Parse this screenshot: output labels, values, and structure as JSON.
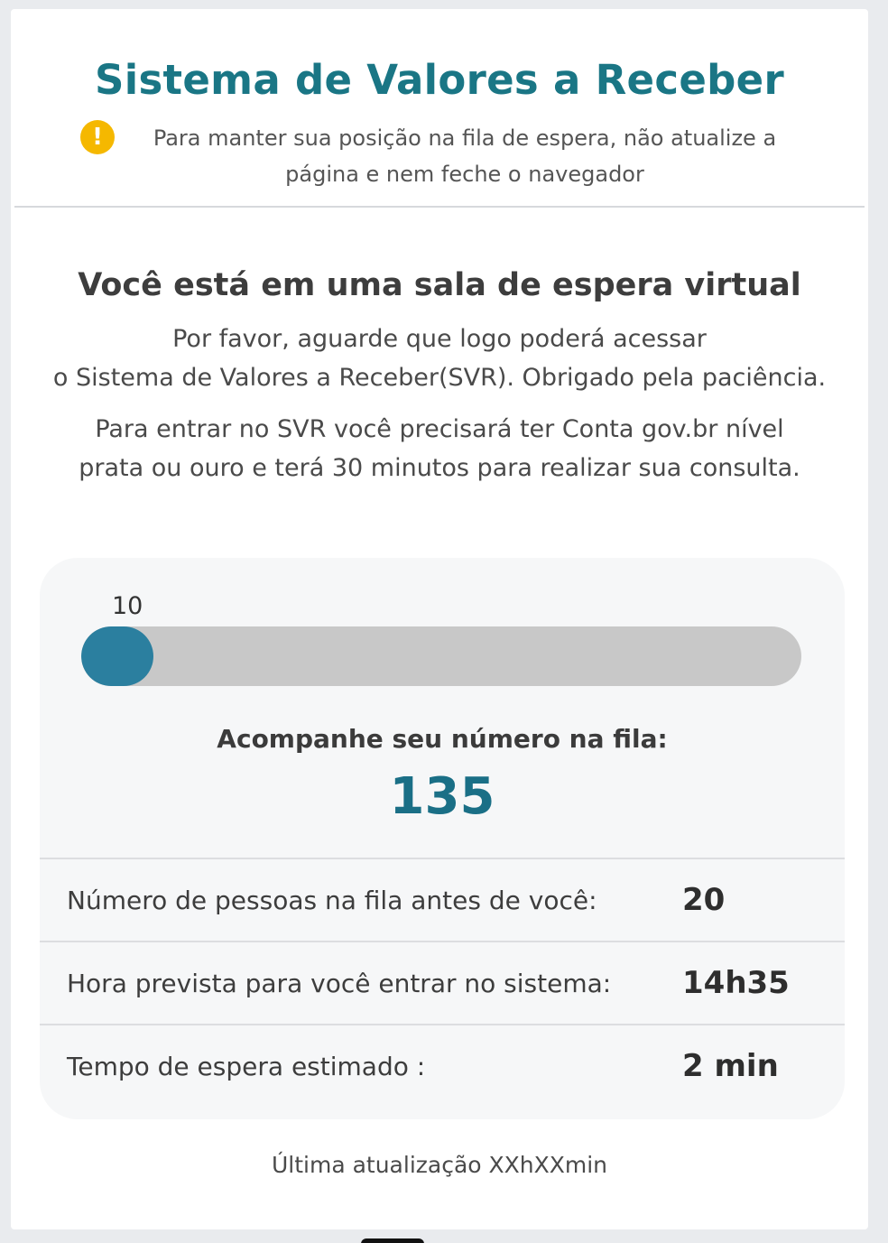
{
  "header": {
    "title": "Sistema de Valores a Receber",
    "warning_icon": "exclamation-icon",
    "warning_text": "Para manter sua posição na fila de espera, não atualize a página e nem feche o navegador"
  },
  "main": {
    "heading": "Você está em uma sala de espera virtual",
    "intro_line1": "Por favor, aguarde que logo poderá acessar",
    "intro_line2": "o Sistema de Valores a Receber(SVR). Obrigado pela paciência.",
    "info_line1": "Para entrar no SVR você precisará ter Conta gov.br nível",
    "info_line2": "prata ou ouro e terá 30 minutos para realizar sua consulta."
  },
  "queue": {
    "progress_label": "10",
    "progress_percent": 10,
    "follow_label": "Acompanhe seu número na fila:",
    "number": "135",
    "stats": [
      {
        "label": "Número de pessoas na fila antes de você:",
        "value": "20"
      },
      {
        "label": "Hora prevista para você entrar no sistema:",
        "value": "14h35"
      },
      {
        "label": "Tempo de espera estimado :",
        "value": "2 min"
      }
    ]
  },
  "footer": {
    "last_update": "Última atualização XXhXXmin"
  },
  "colors": {
    "title": "#1a7685",
    "warning": "#f5b800",
    "progress_fill": "#2b7f9f",
    "progress_track": "#c8c8c8",
    "queue_number": "#1a6f86"
  }
}
